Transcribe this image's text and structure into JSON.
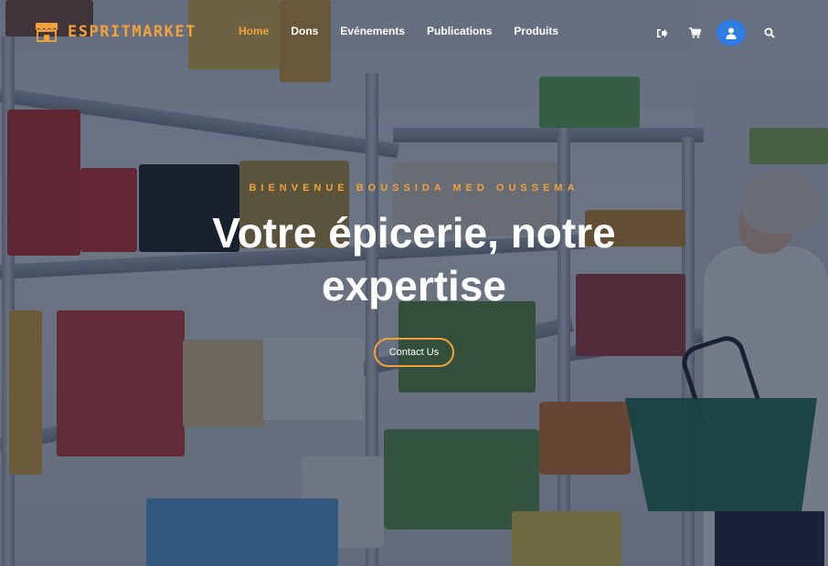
{
  "brand": {
    "name": "ESPRITMARKET",
    "icon": "store-icon",
    "accent": "#f3a23a"
  },
  "nav": [
    {
      "label": "Home",
      "active": true
    },
    {
      "label": "Dons",
      "active": false
    },
    {
      "label": "Evénements",
      "active": false
    },
    {
      "label": "Publications",
      "active": false
    },
    {
      "label": "Produits",
      "active": false
    }
  ],
  "header_icons": [
    "logout-icon",
    "cart-icon",
    "user-icon",
    "search-icon"
  ],
  "hero": {
    "welcome": "BIENVENUE BOUSSIDA MED OUSSEMA",
    "title": "Votre épicerie, notre expertise",
    "cta_label": "Contact Us"
  },
  "colors": {
    "accent": "#f3a23a",
    "user_button": "#2f7de3",
    "overlay": "#16223a"
  }
}
